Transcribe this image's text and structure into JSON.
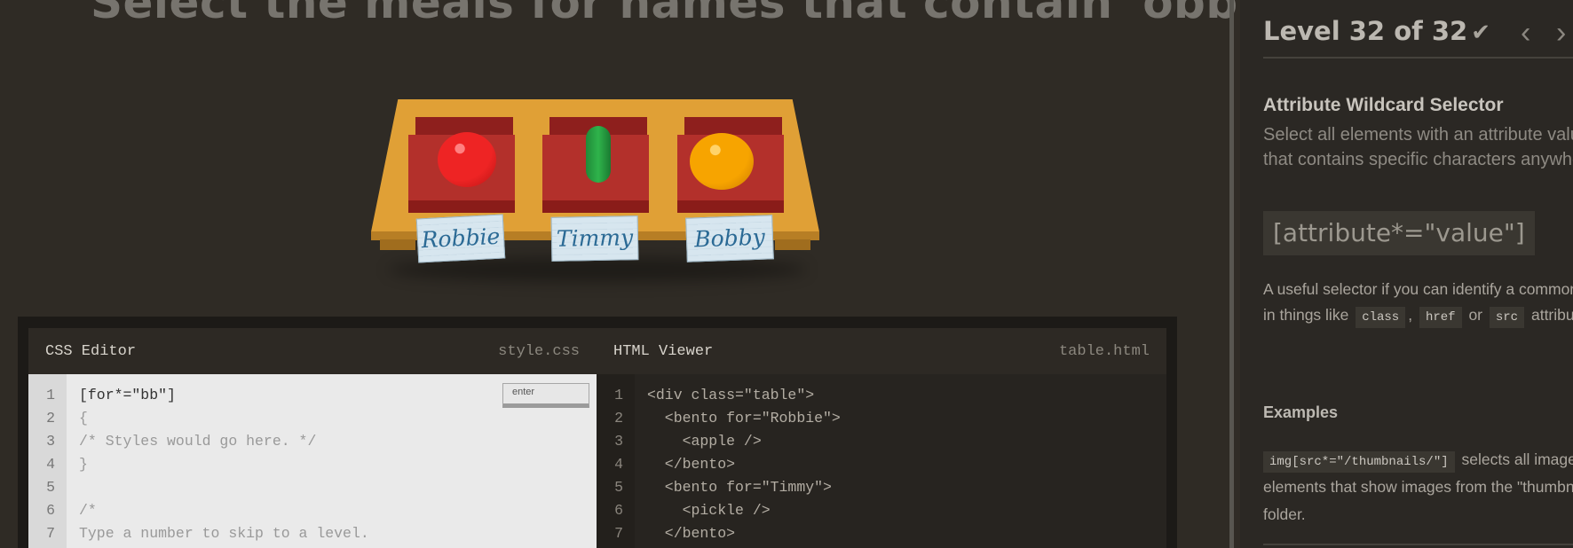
{
  "game": {
    "order": "Select the meals for names that contain 'obb'",
    "bentos": [
      {
        "name": "Robbie",
        "item": "apple"
      },
      {
        "name": "Timmy",
        "item": "pickle"
      },
      {
        "name": "Bobby",
        "item": "orange"
      }
    ]
  },
  "css_editor": {
    "title": "CSS Editor",
    "filename": "style.css",
    "enter_label": "enter",
    "lines": [
      {
        "n": "1",
        "text": "[for*=\"bb\"]"
      },
      {
        "n": "2",
        "text": "{"
      },
      {
        "n": "3",
        "text": "/* Styles would go here. */"
      },
      {
        "n": "4",
        "text": "}"
      },
      {
        "n": "5",
        "text": ""
      },
      {
        "n": "6",
        "text": "/*"
      },
      {
        "n": "7",
        "text": "Type a number to skip to a level."
      }
    ]
  },
  "html_viewer": {
    "title": "HTML Viewer",
    "filename": "table.html",
    "lines": [
      {
        "n": "1",
        "text": "<div class=\"table\">"
      },
      {
        "n": "2",
        "text": "  <bento for=\"Robbie\">"
      },
      {
        "n": "3",
        "text": "    <apple />"
      },
      {
        "n": "4",
        "text": "  </bento>"
      },
      {
        "n": "5",
        "text": "  <bento for=\"Timmy\">"
      },
      {
        "n": "6",
        "text": "    <pickle />"
      },
      {
        "n": "7",
        "text": "  </bento>"
      }
    ]
  },
  "sidebar": {
    "level_title": "Level 32 of 32",
    "check_icon": "check-icon",
    "prev_icon": "chevron-left-icon",
    "next_icon": "chevron-right-icon",
    "selector_name": "Attribute Wildcard Selector",
    "selector_title": "Select all elements with an attribute value that contains specific characters anywhere",
    "syntax": "[attribute*=\"value\"]",
    "hint_pre": "A useful selector if you can identify a common pattern in things like",
    "hint_code_1": "class",
    "hint_sep": ",",
    "hint_code_2": "href",
    "hint_or": "or",
    "hint_code_3": "src",
    "hint_post": "attributes.",
    "examples_label": "Examples",
    "example_code": "img[src*=\"/thumbnails/\"]",
    "example_text": "selects all image elements that show images from the \"thumbnails\" folder."
  },
  "colors": {
    "background": "#2f2b25",
    "sidebar": "#2b2824",
    "bento_red": "#b3302b",
    "table_orange": "#e0a036",
    "tag_blue": "#2b6a95"
  }
}
